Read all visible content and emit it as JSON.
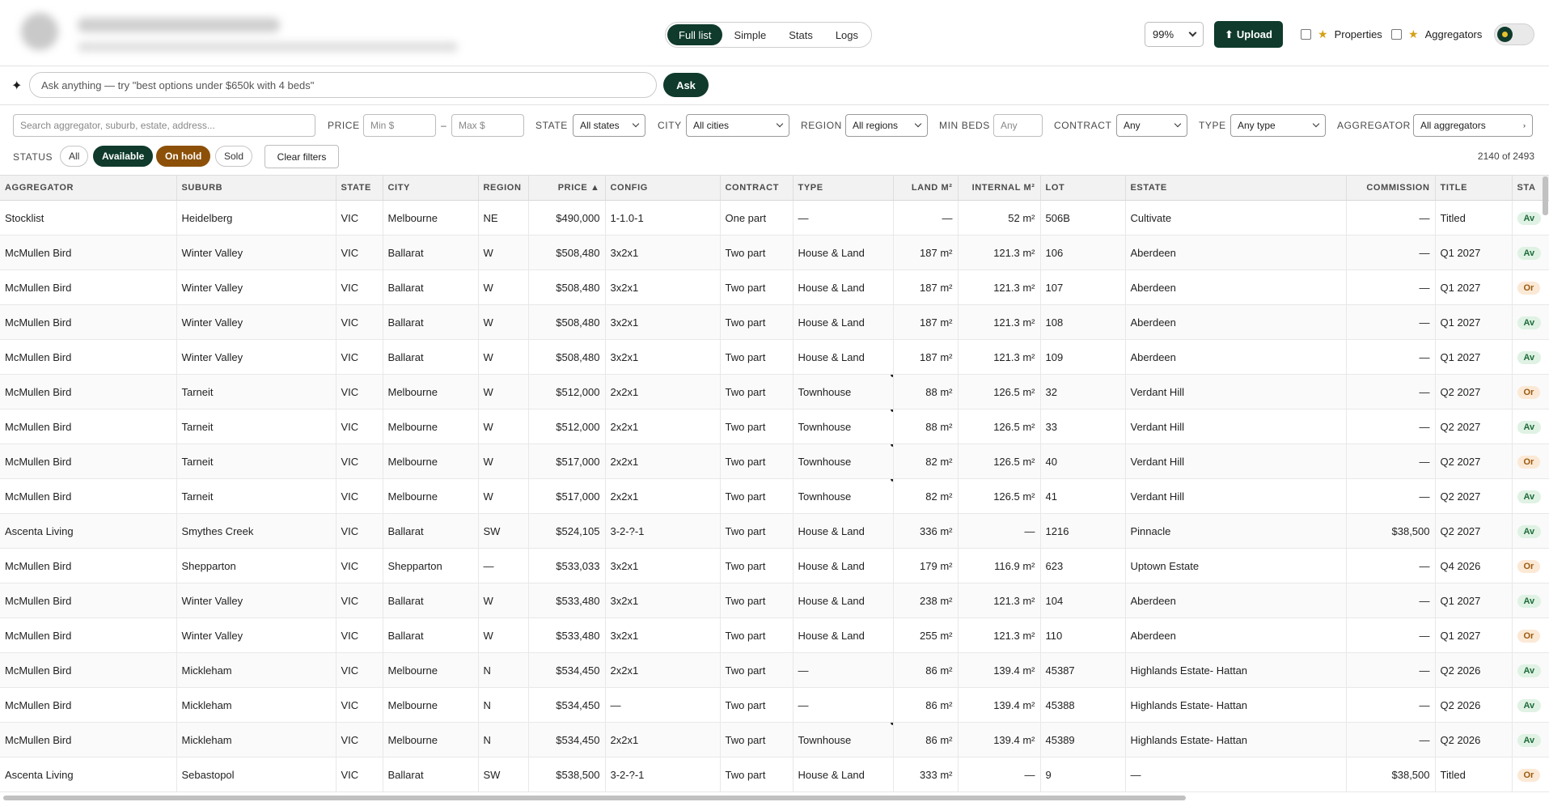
{
  "header": {
    "view_tabs": [
      "Full list",
      "Simple",
      "Stats",
      "Logs"
    ],
    "zoom_value": "99%",
    "upload_label": "Upload",
    "properties_label": "Properties",
    "aggregators_label": "Aggregators"
  },
  "ask": {
    "placeholder": "Ask anything — try \"best options under $650k with 4 beds\"",
    "button_label": "Ask"
  },
  "filters": {
    "search_placeholder": "Search aggregator, suburb, estate, address...",
    "price_label": "PRICE",
    "min_placeholder": "Min $",
    "max_placeholder": "Max $",
    "state_label": "STATE",
    "state_value": "All states",
    "city_label": "CITY",
    "city_value": "All cities",
    "region_label": "REGION",
    "region_value": "All regions",
    "min_beds_label": "MIN BEDS",
    "min_beds_placeholder": "Any",
    "contract_label": "CONTRACT",
    "contract_value": "Any",
    "type_label": "TYPE",
    "type_value": "Any type",
    "aggregator_label": "AGGREGATOR",
    "aggregator_value": "All aggregators",
    "status_label": "STATUS",
    "status_pills": [
      "All",
      "Available",
      "On hold",
      "Sold"
    ],
    "clear_label": "Clear filters",
    "count_text": "2140 of 2493"
  },
  "table": {
    "columns": [
      "AGGREGATOR",
      "SUBURB",
      "STATE",
      "CITY",
      "REGION",
      "PRICE ▲",
      "CONFIG",
      "CONTRACT",
      "TYPE",
      "LAND M²",
      "INTERNAL M²",
      "LOT",
      "ESTATE",
      "COMMISSION",
      "TITLE",
      "STA"
    ],
    "rows": [
      {
        "aggregator": "Stocklist",
        "suburb": "Heidelberg",
        "state": "VIC",
        "city": "Melbourne",
        "region": "NE",
        "price": "$490,000",
        "config": "1-1.0-1",
        "contract": "One part",
        "type": "—",
        "land": "—",
        "internal": "52 m²",
        "lot": "506B",
        "estate": "Cultivate",
        "commission": "—",
        "title": "Titled",
        "status": "Av"
      },
      {
        "aggregator": "McMullen Bird",
        "suburb": "Winter Valley",
        "state": "VIC",
        "city": "Ballarat",
        "region": "W",
        "price": "$508,480",
        "config": "3x2x1",
        "contract": "Two part",
        "type": "House & Land",
        "land": "187 m²",
        "internal": "121.3 m²",
        "lot": "106",
        "estate": "Aberdeen",
        "commission": "—",
        "title": "Q1 2027",
        "status": "Av"
      },
      {
        "aggregator": "McMullen Bird",
        "suburb": "Winter Valley",
        "state": "VIC",
        "city": "Ballarat",
        "region": "W",
        "price": "$508,480",
        "config": "3x2x1",
        "contract": "Two part",
        "type": "House & Land",
        "land": "187 m²",
        "internal": "121.3 m²",
        "lot": "107",
        "estate": "Aberdeen",
        "commission": "—",
        "title": "Q1 2027",
        "status": "Or"
      },
      {
        "aggregator": "McMullen Bird",
        "suburb": "Winter Valley",
        "state": "VIC",
        "city": "Ballarat",
        "region": "W",
        "price": "$508,480",
        "config": "3x2x1",
        "contract": "Two part",
        "type": "House & Land",
        "land": "187 m²",
        "internal": "121.3 m²",
        "lot": "108",
        "estate": "Aberdeen",
        "commission": "—",
        "title": "Q1 2027",
        "status": "Av"
      },
      {
        "aggregator": "McMullen Bird",
        "suburb": "Winter Valley",
        "state": "VIC",
        "city": "Ballarat",
        "region": "W",
        "price": "$508,480",
        "config": "3x2x1",
        "contract": "Two part",
        "type": "House & Land",
        "land": "187 m²",
        "internal": "121.3 m²",
        "lot": "109",
        "estate": "Aberdeen",
        "commission": "—",
        "title": "Q1 2027",
        "status": "Av"
      },
      {
        "aggregator": "McMullen Bird",
        "suburb": "Tarneit",
        "state": "VIC",
        "city": "Melbourne",
        "region": "W",
        "price": "$512,000",
        "config": "2x2x1",
        "contract": "Two part",
        "type": "Townhouse",
        "land": "88 m²",
        "internal": "126.5 m²",
        "lot": "32",
        "estate": "Verdant Hill",
        "commission": "—",
        "title": "Q2 2027",
        "status": "Or"
      },
      {
        "aggregator": "McMullen Bird",
        "suburb": "Tarneit",
        "state": "VIC",
        "city": "Melbourne",
        "region": "W",
        "price": "$512,000",
        "config": "2x2x1",
        "contract": "Two part",
        "type": "Townhouse",
        "land": "88 m²",
        "internal": "126.5 m²",
        "lot": "33",
        "estate": "Verdant Hill",
        "commission": "—",
        "title": "Q2 2027",
        "status": "Av"
      },
      {
        "aggregator": "McMullen Bird",
        "suburb": "Tarneit",
        "state": "VIC",
        "city": "Melbourne",
        "region": "W",
        "price": "$517,000",
        "config": "2x2x1",
        "contract": "Two part",
        "type": "Townhouse",
        "land": "82 m²",
        "internal": "126.5 m²",
        "lot": "40",
        "estate": "Verdant Hill",
        "commission": "—",
        "title": "Q2 2027",
        "status": "Or"
      },
      {
        "aggregator": "McMullen Bird",
        "suburb": "Tarneit",
        "state": "VIC",
        "city": "Melbourne",
        "region": "W",
        "price": "$517,000",
        "config": "2x2x1",
        "contract": "Two part",
        "type": "Townhouse",
        "land": "82 m²",
        "internal": "126.5 m²",
        "lot": "41",
        "estate": "Verdant Hill",
        "commission": "—",
        "title": "Q2 2027",
        "status": "Av"
      },
      {
        "aggregator": "Ascenta Living",
        "suburb": "Smythes Creek",
        "state": "VIC",
        "city": "Ballarat",
        "region": "SW",
        "price": "$524,105",
        "config": "3-2-?-1",
        "contract": "Two part",
        "type": "House & Land",
        "land": "336 m²",
        "internal": "—",
        "lot": "1216",
        "estate": "Pinnacle",
        "commission": "$38,500",
        "title": "Q2 2027",
        "status": "Av"
      },
      {
        "aggregator": "McMullen Bird",
        "suburb": "Shepparton",
        "state": "VIC",
        "city": "Shepparton",
        "region": "—",
        "price": "$533,033",
        "config": "3x2x1",
        "contract": "Two part",
        "type": "House & Land",
        "land": "179 m²",
        "internal": "116.9 m²",
        "lot": "623",
        "estate": "Uptown Estate",
        "commission": "—",
        "title": "Q4 2026",
        "status": "Or"
      },
      {
        "aggregator": "McMullen Bird",
        "suburb": "Winter Valley",
        "state": "VIC",
        "city": "Ballarat",
        "region": "W",
        "price": "$533,480",
        "config": "3x2x1",
        "contract": "Two part",
        "type": "House & Land",
        "land": "238 m²",
        "internal": "121.3 m²",
        "lot": "104",
        "estate": "Aberdeen",
        "commission": "—",
        "title": "Q1 2027",
        "status": "Av"
      },
      {
        "aggregator": "McMullen Bird",
        "suburb": "Winter Valley",
        "state": "VIC",
        "city": "Ballarat",
        "region": "W",
        "price": "$533,480",
        "config": "3x2x1",
        "contract": "Two part",
        "type": "House & Land",
        "land": "255 m²",
        "internal": "121.3 m²",
        "lot": "110",
        "estate": "Aberdeen",
        "commission": "—",
        "title": "Q1 2027",
        "status": "Or"
      },
      {
        "aggregator": "McMullen Bird",
        "suburb": "Mickleham",
        "state": "VIC",
        "city": "Melbourne",
        "region": "N",
        "price": "$534,450",
        "config": "2x2x1",
        "contract": "Two part",
        "type": "—",
        "land": "86 m²",
        "internal": "139.4 m²",
        "lot": "45387",
        "estate": "Highlands Estate- Hattan",
        "commission": "—",
        "title": "Q2 2026",
        "status": "Av"
      },
      {
        "aggregator": "McMullen Bird",
        "suburb": "Mickleham",
        "state": "VIC",
        "city": "Melbourne",
        "region": "N",
        "price": "$534,450",
        "config": "—",
        "contract": "Two part",
        "type": "—",
        "land": "86 m²",
        "internal": "139.4 m²",
        "lot": "45388",
        "estate": "Highlands Estate- Hattan",
        "commission": "—",
        "title": "Q2 2026",
        "status": "Av"
      },
      {
        "aggregator": "McMullen Bird",
        "suburb": "Mickleham",
        "state": "VIC",
        "city": "Melbourne",
        "region": "N",
        "price": "$534,450",
        "config": "2x2x1",
        "contract": "Two part",
        "type": "Townhouse",
        "land": "86 m²",
        "internal": "139.4 m²",
        "lot": "45389",
        "estate": "Highlands Estate- Hattan",
        "commission": "—",
        "title": "Q2 2026",
        "status": "Av"
      },
      {
        "aggregator": "Ascenta Living",
        "suburb": "Sebastopol",
        "state": "VIC",
        "city": "Ballarat",
        "region": "SW",
        "price": "$538,500",
        "config": "3-2-?-1",
        "contract": "Two part",
        "type": "House & Land",
        "land": "333 m²",
        "internal": "—",
        "lot": "9",
        "estate": "—",
        "commission": "$38,500",
        "title": "Titled",
        "status": "Or"
      }
    ]
  }
}
